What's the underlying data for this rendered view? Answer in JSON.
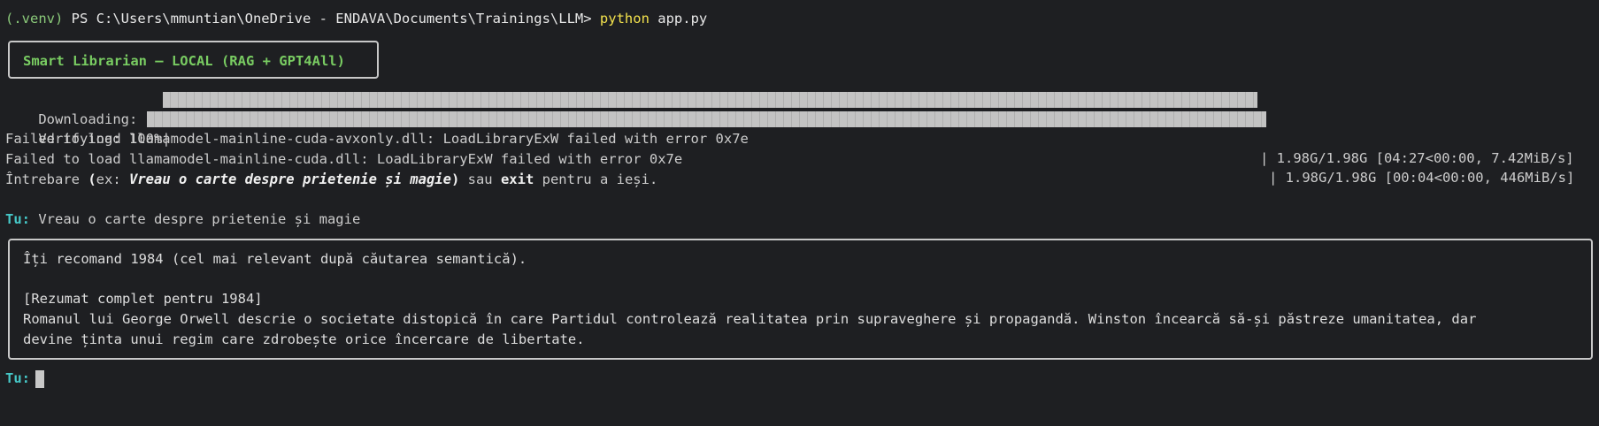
{
  "prompt": {
    "venv": "(.venv)",
    "path": " PS C:\\Users\\mmuntian\\OneDrive - ENDAVA\\Documents\\Trainings\\LLM> ",
    "cmd": "python",
    "arg": " app.py"
  },
  "title": "Smart Librarian – LOCAL (RAG + GPT4All)",
  "download": {
    "label": "Downloading: 100%|",
    "fill_fraction": 1.0,
    "suffix": "| 1.98G/1.98G [04:27<00:00, 7.42MiB/s]"
  },
  "verify": {
    "label": "Verifying: 100%|",
    "fill_fraction": 1.0,
    "suffix": "| 1.98G/1.98G [00:04<00:00, 446MiB/s]"
  },
  "errors": [
    "Failed to load llamamodel-mainline-cuda-avxonly.dll: LoadLibraryExW failed with error 0x7e",
    "Failed to load llamamodel-mainline-cuda.dll: LoadLibraryExW failed with error 0x7e"
  ],
  "instruction": {
    "pre": "Întrebare ",
    "open": "(",
    "ex": "ex: ",
    "example": "Vreau o carte despre prietenie și magie",
    "close": ")",
    "mid": " sau ",
    "exit": "exit",
    "post": " pentru a ieși."
  },
  "user_turn": {
    "label": "Tu:",
    "text": " Vreau o carte despre prietenie și magie"
  },
  "answer": {
    "line1": "Îți recomand 1984 (cel mai relevant după căutarea semantică).",
    "line2": "[Rezumat complet pentru 1984]",
    "line3": "Romanul lui George Orwell descrie o societate distopică în care Partidul controlează realitatea prin supraveghere și propagandă. Winston încearcă să-și păstreze umanitatea, dar",
    "line4": "devine ținta unui regim care zdrobește orice încercare de libertate."
  },
  "input_turn": {
    "label": "Tu:"
  }
}
